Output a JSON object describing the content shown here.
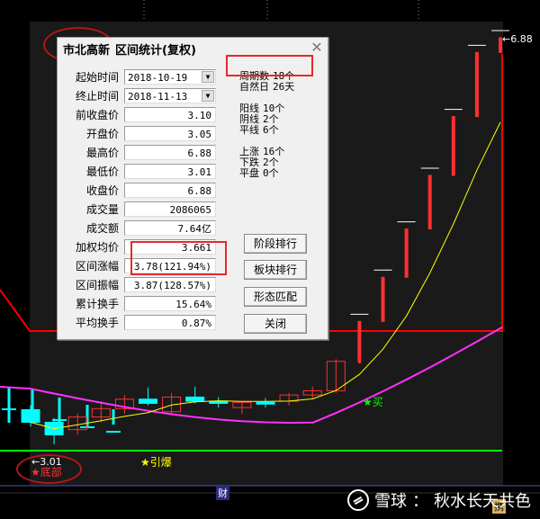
{
  "chart_data": {
    "type": "candlestick",
    "price_high_label": "6.88",
    "price_low_label": "3.01",
    "annotations": {
      "bottom_marker": "★底部",
      "ignite_marker": "★引爆",
      "buy_marker": "★买",
      "axis_tag_cai": "财",
      "corner_tag": "携"
    },
    "candles": [
      {
        "o": 3.34,
        "h": 3.38,
        "l": 3.18,
        "c": 3.22
      },
      {
        "o": 3.22,
        "h": 3.26,
        "l": 3.01,
        "c": 3.1
      },
      {
        "o": 3.15,
        "h": 3.3,
        "l": 3.1,
        "c": 3.27
      },
      {
        "o": 3.27,
        "h": 3.42,
        "l": 3.22,
        "c": 3.35
      },
      {
        "o": 3.35,
        "h": 3.48,
        "l": 3.3,
        "c": 3.44
      },
      {
        "o": 3.44,
        "h": 3.55,
        "l": 3.38,
        "c": 3.4
      },
      {
        "o": 3.32,
        "h": 3.5,
        "l": 3.29,
        "c": 3.46
      },
      {
        "o": 3.46,
        "h": 3.56,
        "l": 3.4,
        "c": 3.42
      },
      {
        "o": 3.42,
        "h": 3.46,
        "l": 3.36,
        "c": 3.4
      },
      {
        "o": 3.36,
        "h": 3.42,
        "l": 3.3,
        "c": 3.41
      },
      {
        "o": 3.41,
        "h": 3.45,
        "l": 3.36,
        "c": 3.4
      },
      {
        "o": 3.42,
        "h": 3.5,
        "l": 3.38,
        "c": 3.48
      },
      {
        "o": 3.48,
        "h": 3.56,
        "l": 3.44,
        "c": 3.52
      },
      {
        "o": 3.52,
        "h": 3.82,
        "l": 3.5,
        "c": 3.8
      },
      {
        "o": 3.8,
        "h": 4.18,
        "l": 3.78,
        "c": 4.18
      },
      {
        "o": 4.18,
        "h": 4.6,
        "l": 4.18,
        "c": 4.6
      },
      {
        "o": 4.6,
        "h": 5.06,
        "l": 4.6,
        "c": 5.06
      },
      {
        "o": 5.06,
        "h": 5.57,
        "l": 5.06,
        "c": 5.57
      },
      {
        "o": 5.57,
        "h": 6.13,
        "l": 5.57,
        "c": 6.13
      },
      {
        "o": 6.13,
        "h": 6.74,
        "l": 6.13,
        "c": 6.74
      },
      {
        "o": 6.74,
        "h": 6.88,
        "l": 6.74,
        "c": 6.88
      }
    ]
  },
  "dialog": {
    "title_stock": "市北高新",
    "title_rest": "区间统计(复权)",
    "close_glyph": "✕",
    "dropdown_glyph": "▼",
    "fields": [
      {
        "label": "起始时间",
        "value": "2018-10-19",
        "kind": "date"
      },
      {
        "label": "终止时间",
        "value": "2018-11-13",
        "kind": "date"
      },
      {
        "label": "前收盘价",
        "value": "3.10"
      },
      {
        "label": "开盘价",
        "value": "3.05"
      },
      {
        "label": "最高价",
        "value": "6.88"
      },
      {
        "label": "最低价",
        "value": "3.01"
      },
      {
        "label": "收盘价",
        "value": "6.88"
      },
      {
        "label": "成交量",
        "value": "2086065"
      },
      {
        "label": "成交额",
        "value": "7.64亿"
      },
      {
        "label": "加权均价",
        "value": "3.661"
      },
      {
        "label": "区间涨幅",
        "value": "3.78(121.94%)"
      },
      {
        "label": "区间振幅",
        "value": "3.87(128.57%)"
      },
      {
        "label": "累计换手",
        "value": "15.64%"
      },
      {
        "label": "平均换手",
        "value": "0.87%"
      }
    ],
    "stats": [
      {
        "label": "周期数",
        "value": "18个"
      },
      {
        "label": "自然日",
        "value": "26天"
      },
      {
        "label": "阳线",
        "value": "10个"
      },
      {
        "label": "阴线",
        "value": "2个"
      },
      {
        "label": "平线",
        "value": "6个"
      },
      {
        "label": "上涨",
        "value": "16个"
      },
      {
        "label": "下跌",
        "value": "2个"
      },
      {
        "label": "平盘",
        "value": "0个"
      }
    ],
    "buttons": {
      "stage_rank": "阶段排行",
      "sector_rank": "板块排行",
      "pattern_match": "形态匹配",
      "close": "关闭"
    }
  },
  "watermark": {
    "brand": "雪球",
    "separator": "：",
    "author": "秋水长天共色"
  },
  "colors": {
    "up": "#ff3030",
    "down": "#00ffff",
    "ma_yellow": "#ffff00",
    "ma_magenta": "#ff30ff",
    "support_green": "#00ff00",
    "resistance_red": "#ff0000",
    "annotation_red": "#e82828"
  }
}
